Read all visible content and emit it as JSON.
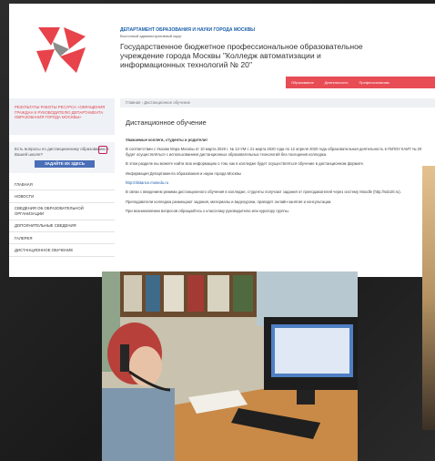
{
  "header": {
    "department": "ДЕПАРТАМЕНТ ОБРАЗОВАНИЯ И НАУКИ ГОРОДА МОСКВЫ",
    "department_sub": "Восточный административный округ",
    "org_name": "Государственное бюджетное профессиональное образовательное учреждение города Москвы \"Колледж автоматизации и информационных технологий № 20\"",
    "nav": [
      "Образование",
      "Деятельность",
      "Профессионалам"
    ]
  },
  "sidebar": {
    "results_link": "РЕЗУЛЬТАТЫ РАБОТЫ РЕСУРСА «ОБРАЩЕНИЯ ГРАЖДАН К РУКОВОДИТЕЛЮ ДЕПАРТАМЕНТА ОБРАЗОВАНИЯ ГОРОДА МОСКВЫ»",
    "ask_text": "Есть вопросы по дистанционному образованию в Вашей школе?",
    "ask_button": "ЗАДАЙТЕ ИХ ЗДЕСЬ",
    "menu": [
      "ГЛАВНАЯ",
      "НОВОСТИ",
      "СВЕДЕНИЯ ОБ ОБРАЗОВАТЕЛЬНОЙ ОРГАНИЗАЦИИ",
      "ДОПОЛНИТЕЛЬНЫЕ СВЕДЕНИЯ",
      "ГАЛЕРЕЯ",
      "ДИСТАНЦИОННОЕ ОБУЧЕНИЕ"
    ]
  },
  "main": {
    "breadcrumb": "Главная › Дистанционное обучение",
    "title": "Дистанционное обучение",
    "greeting": "Уважаемые коллеги, студенты и родители!",
    "paragraphs": [
      "В соответствии с Указом Мэра Москвы от 10 марта 2020 г. № 12-УМ с 21 марта 2020 года по 12 апреля 2020 года образовательная деятельность в ГБПОУ КАИТ № 20 будет осуществляться с использованием дистанционных образовательных технологий без посещения колледжа.",
      "В этом разделе вы можете найти всю информацию о том, как в колледже будет осуществляться обучение в дистанционном формате.",
      "Информация Департамента образования и науки города Москвы"
    ],
    "link": "http://distance.mosedu.ru",
    "paragraphs2": [
      "В связи с введением режима дистанционного обучения в колледже, студенты получают задания от преподавателей через систему Moodle (http://sdo20.ru).",
      "Преподаватели колледжа размещают задания, материалы и видеоуроки, проводят онлайн-занятия и консультации.",
      "При возникновении вопросов обращайтесь к классному руководителю или куратору группы."
    ]
  },
  "colors": {
    "accent_red": "#e84c55",
    "link_blue": "#1a5ea8",
    "button_blue": "#4a6fb8"
  }
}
